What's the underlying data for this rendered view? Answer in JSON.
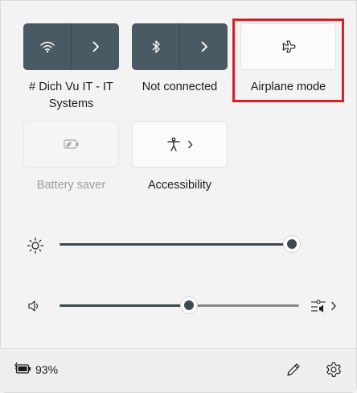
{
  "tiles": {
    "wifi": {
      "label": "# Dich Vu IT - IT Systems",
      "line1": "# Dich Vu IT - IT",
      "line2": "Systems",
      "icon": "wifi-icon"
    },
    "bluetooth": {
      "label": "Not connected",
      "icon": "bluetooth-icon"
    },
    "airplane": {
      "label": "Airplane mode",
      "icon": "airplane-icon"
    },
    "battery_saver": {
      "label": "Battery saver",
      "icon": "battery-saver-icon"
    },
    "accessibility": {
      "label": "Accessibility",
      "icon": "accessibility-icon"
    }
  },
  "brightness": {
    "icon": "sun-icon",
    "level": 1.0
  },
  "volume": {
    "icon": "speaker-icon",
    "level": 0.5,
    "output_icon": "audio-output-icon"
  },
  "footer": {
    "battery_percent": "93%",
    "battery_icon": "battery-charging-icon",
    "edit_icon": "pencil-icon",
    "settings_icon": "gear-icon"
  },
  "colors": {
    "accent_tile": "#4a5a64",
    "highlight": "#d3222a",
    "slider_fill": "#3c4a53"
  }
}
